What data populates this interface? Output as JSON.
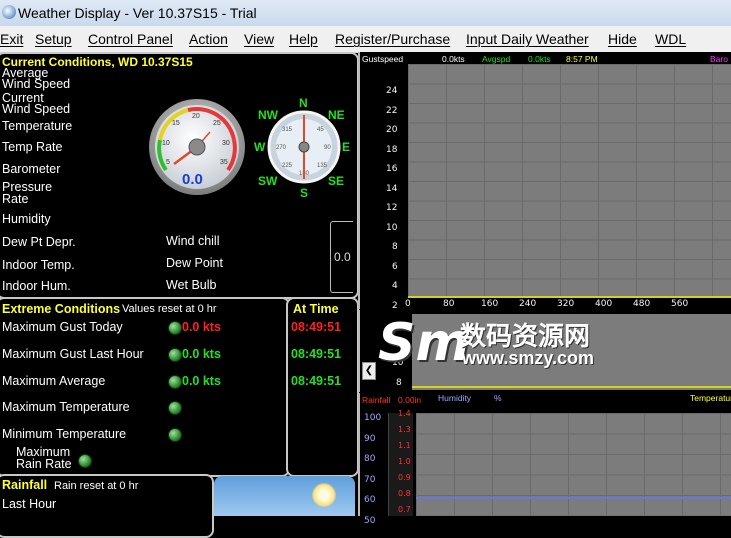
{
  "window": {
    "title": "Weather Display - Ver 10.37S15 - Trial",
    "app_icon": "weather-app-icon"
  },
  "menu": [
    "Exit",
    "Setup",
    "Control Panel",
    "Action",
    "View",
    "Help",
    "Register/Purchase",
    "Input Daily Weather",
    "Hide",
    "WDL"
  ],
  "current": {
    "header": "Current Conditions, WD 10.37S15",
    "labels": {
      "avg_wind": "Average\nWind Speed",
      "cur_wind": "Current\nWind Speed",
      "temperature": "Temperature",
      "temp_rate": "Temp Rate",
      "barometer": "Barometer",
      "pressure_rate": "Pressure\nRate",
      "humidity": "Humidity",
      "dew_pt_depr": "Dew Pt Depr.",
      "indoor_temp": "Indoor Temp.",
      "indoor_hum": "Indoor Hum.",
      "wind_chill": "Wind chill",
      "dew_point": "Dew Point",
      "wet_bulb": "Wet Bulb"
    },
    "wind_gauge_value": "0.0",
    "gauge_ticks": [
      "5",
      "10",
      "15",
      "20",
      "25",
      "30",
      "35"
    ],
    "compass": {
      "n": "N",
      "ne": "NE",
      "e": "E",
      "se": "SE",
      "s": "S",
      "sw": "SW",
      "w": "W",
      "nw": "NW",
      "degrees": [
        "315",
        "45",
        "270",
        "90",
        "225",
        "135",
        "180"
      ]
    },
    "side_value": "0.0"
  },
  "extreme": {
    "header": "Extreme Conditions",
    "reset_note": "Values reset at 0 hr",
    "at_time_header": "At Time",
    "rows": [
      {
        "label": "Maximum Gust Today",
        "value": "0.0 kts",
        "time": "08:49:51",
        "value_color": "#ff2020",
        "time_color": "#ff2020"
      },
      {
        "label": "Maximum Gust Last Hour",
        "value": "0.0 kts",
        "time": "08:49:51",
        "value_color": "#22e022",
        "time_color": "#22e022"
      },
      {
        "label": "Maximum Average",
        "value": "0.0 kts",
        "time": "08:49:51",
        "value_color": "#22e022",
        "time_color": "#22e022"
      },
      {
        "label": "Maximum Temperature",
        "value": "",
        "time": ""
      },
      {
        "label": "Minimum Temperature",
        "value": "",
        "time": ""
      },
      {
        "label": "Maximum\nRain Rate",
        "value": "",
        "time": ""
      }
    ]
  },
  "rainfall": {
    "header": "Rainfall",
    "reset_note": "Rain reset at 0 hr",
    "last_hour": "Last Hour"
  },
  "wind_graph": {
    "gust_label": "Gustspeed",
    "gust_value": "0.0kts",
    "avg_label": "Avgspd",
    "avg_value": "0.0kts",
    "time": "8:57 PM",
    "baro_label": "Baro",
    "y_ticks": [
      "24",
      "22",
      "20",
      "18",
      "16",
      "14",
      "12",
      "10",
      "8",
      "6",
      "4",
      "2"
    ],
    "x_ticks": [
      "0",
      "80",
      "160",
      "240",
      "320",
      "400",
      "480",
      "560"
    ]
  },
  "mid_graph": {
    "y_ticks": [
      "10",
      "8"
    ]
  },
  "lower_graph": {
    "rain_label": "Rainfall",
    "rain_value": "0.00in",
    "humidity_label": "Humidity",
    "humidity_unit": "%",
    "temp_label": "Temperature",
    "y_left": [
      "100",
      "90",
      "80",
      "70",
      "60",
      "50"
    ],
    "y_right": [
      "1.4",
      "1.3",
      "1.1",
      "1.0",
      "0.9",
      "0.8",
      "0.7"
    ]
  },
  "watermark": {
    "brand": "数码资源网",
    "url": "www.smzy.com"
  },
  "colors": {
    "label_yellow": "#ffff33",
    "value_green": "#22e022",
    "value_red": "#ff2020",
    "graph_bg": "#7c7c7c"
  }
}
